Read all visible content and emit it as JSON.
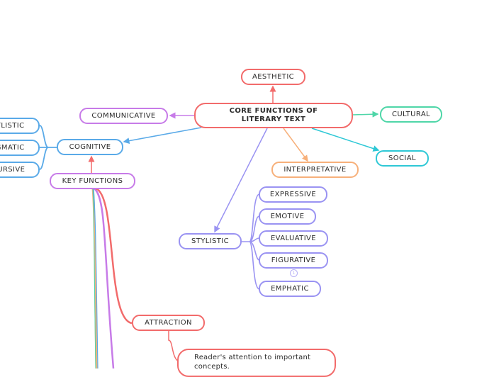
{
  "colors": {
    "red": "#f26b6b",
    "purple": "#c77be8",
    "blue": "#5aaae8",
    "teal": "#4fd6a8",
    "cyan": "#2ec8d6",
    "orange": "#f7b07a",
    "violet": "#9a93f2"
  },
  "root": {
    "label": "CORE FUNCTIONS OF LITERARY TEXT"
  },
  "nodes": {
    "aesthetic": "AESTHETIC",
    "communicative": "COMMUNICATIVE",
    "cultural": "CULTURAL",
    "cognitive": "COGNITIVE",
    "social": "SOCIAL",
    "interpretative": "INTERPRETATIVE",
    "stylistic": "STYLISTIC",
    "key_functions": "KEY FUNCTIONS",
    "attraction": "ATTRACTION"
  },
  "cognitive_children": [
    "STYLISTIC",
    "PRAGMATIC",
    "DISCURSIVE"
  ],
  "stylistic_children": [
    "EXPRESSIVE",
    "EMOTIVE",
    "EVALUATIVE",
    "FIGURATIVE",
    "EMPHATIC"
  ],
  "figurative_badge": "1",
  "attraction_note": "Reader's attention to important concepts."
}
